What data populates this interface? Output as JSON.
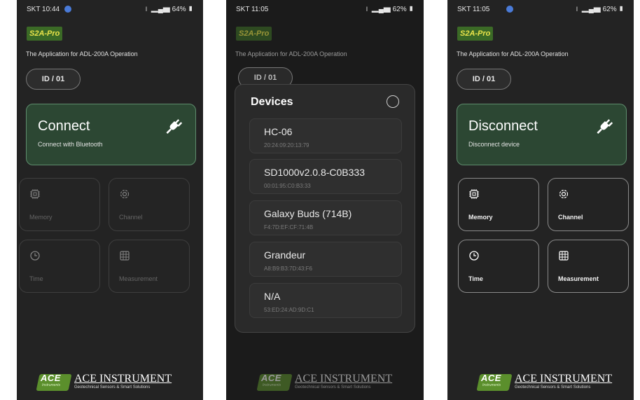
{
  "screens": [
    {
      "status": {
        "time": "SKT 10:44",
        "right": "64%"
      },
      "logo": "S2A-Pro",
      "subtitle": "The Application for ADL-200A Operation",
      "device_id": "ID / 01",
      "connect": {
        "title": "Connect",
        "subtitle": "Connect with Bluetooth"
      },
      "tiles": [
        "Memory",
        "Channel",
        "Time",
        "Measurement"
      ],
      "brand": {
        "badge": "ACE",
        "badge_sub": "Instruments",
        "name": "ACE INSTRUMENT",
        "tagline": "Geotechnical Sensors & Smart Solutions"
      }
    },
    {
      "status": {
        "time": "SKT 11:05",
        "right": "62%"
      },
      "logo": "S2A-Pro",
      "subtitle": "The Application for ADL-200A Operation",
      "device_id": "ID / 01",
      "dialog": {
        "title": "Devices",
        "devices": [
          {
            "name": "HC-06",
            "address": "20:24:09:20:13:79"
          },
          {
            "name": "SD1000v2.0.8-C0B333",
            "address": "00:01:95:C0:B3:33"
          },
          {
            "name": "Galaxy Buds (714B)",
            "address": "F4:7D:EF:CF:71:4B"
          },
          {
            "name": "Grandeur",
            "address": "A8:B9:B3:7D:43:F6"
          },
          {
            "name": "N/A",
            "address": "53:ED:24:AD:9D:C1"
          }
        ]
      },
      "brand": {
        "badge": "ACE",
        "badge_sub": "Instruments",
        "name": "ACE INSTRUMENT",
        "tagline": "Geotechnical Sensors & Smart Solutions"
      }
    },
    {
      "status": {
        "time": "SKT 11:05",
        "right": "62%"
      },
      "logo": "S2A-Pro",
      "subtitle": "The Application for ADL-200A Operation",
      "device_id": "ID / 01",
      "connect": {
        "title": "Disconnect",
        "subtitle": "Disconnect device"
      },
      "tiles": [
        "Memory",
        "Channel",
        "Time",
        "Measurement"
      ],
      "brand": {
        "badge": "ACE",
        "badge_sub": "Instruments",
        "name": "ACE INSTRUMENT",
        "tagline": "Geotechnical Sensors & Smart Solutions"
      }
    }
  ],
  "colors": {
    "accent_green": "#2c4733",
    "accent_border": "#5e8d6d",
    "logo_yellow": "#e9e34a",
    "brand_green": "#5b8f2c"
  }
}
